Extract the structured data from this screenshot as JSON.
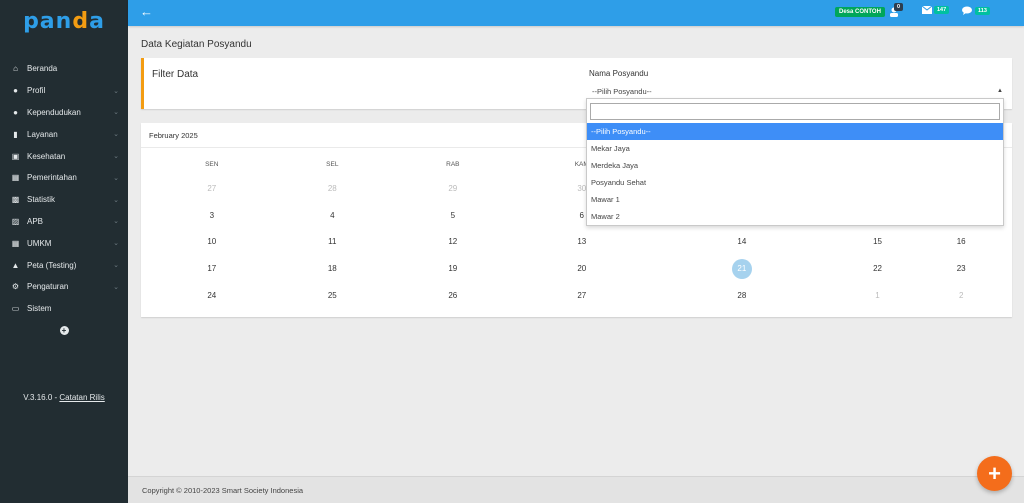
{
  "brand": {
    "logo_text": "panda"
  },
  "sidebar": {
    "items": [
      {
        "label": "Beranda",
        "icon": "home-icon",
        "has_children": false
      },
      {
        "label": "Profil",
        "icon": "user-icon",
        "has_children": true
      },
      {
        "label": "Kependudukan",
        "icon": "users-icon",
        "has_children": true
      },
      {
        "label": "Layanan",
        "icon": "file-icon",
        "has_children": true
      },
      {
        "label": "Kesehatan",
        "icon": "medkit-icon",
        "has_children": true
      },
      {
        "label": "Pemerintahan",
        "icon": "building-icon",
        "has_children": true
      },
      {
        "label": "Statistik",
        "icon": "bar-chart-icon",
        "has_children": true
      },
      {
        "label": "APB",
        "icon": "money-icon",
        "has_children": true
      },
      {
        "label": "UMKM",
        "icon": "grid-icon",
        "has_children": true
      },
      {
        "label": "Peta (Testing)",
        "icon": "map-icon",
        "has_children": true
      },
      {
        "label": "Pengaturan",
        "icon": "gear-icon",
        "has_children": true
      },
      {
        "label": "Sistem",
        "icon": "monitor-icon",
        "has_children": false
      }
    ],
    "version": "V.3.16.0 - ",
    "release_notes_link": "Catatan Rilis"
  },
  "topbar": {
    "desa_label": "Desa CONTOH",
    "notif_count": "0",
    "mail_count": "147",
    "chat_count": "113"
  },
  "page": {
    "title": "Data Kegiatan Posyandu",
    "filter_title": "Filter Data",
    "field_label": "Nama Posyandu",
    "select_value": "--Pilih Posyandu--"
  },
  "dropdown": {
    "search_value": "",
    "options": [
      "--Pilih Posyandu--",
      "Mekar Jaya",
      "Merdeka Jaya",
      "Posyandu Sehat",
      "Mawar 1",
      "Mawar 2"
    ],
    "selected_index": 0
  },
  "calendar": {
    "month_label": "February 2025",
    "weekdays": [
      "SEN",
      "SEL",
      "RAB",
      "KAM",
      "",
      "",
      ""
    ],
    "weeks": [
      [
        {
          "d": "27",
          "muted": true
        },
        {
          "d": "28",
          "muted": true
        },
        {
          "d": "29",
          "muted": true
        },
        {
          "d": "30",
          "muted": true
        },
        {
          "d": "",
          "muted": false
        },
        {
          "d": "",
          "muted": false
        },
        {
          "d": "",
          "muted": false
        }
      ],
      [
        {
          "d": "3"
        },
        {
          "d": "4"
        },
        {
          "d": "5"
        },
        {
          "d": "6"
        },
        {
          "d": ""
        },
        {
          "d": ""
        },
        {
          "d": ""
        }
      ],
      [
        {
          "d": "10"
        },
        {
          "d": "11"
        },
        {
          "d": "12"
        },
        {
          "d": "13"
        },
        {
          "d": "14"
        },
        {
          "d": "15"
        },
        {
          "d": "16"
        }
      ],
      [
        {
          "d": "17"
        },
        {
          "d": "18"
        },
        {
          "d": "19"
        },
        {
          "d": "20"
        },
        {
          "d": "21",
          "today": true
        },
        {
          "d": "22"
        },
        {
          "d": "23"
        }
      ],
      [
        {
          "d": "24"
        },
        {
          "d": "25"
        },
        {
          "d": "26"
        },
        {
          "d": "27"
        },
        {
          "d": "28"
        },
        {
          "d": "1",
          "muted": true
        },
        {
          "d": "2",
          "muted": true
        }
      ]
    ]
  },
  "footer": {
    "copyright": "Copyright © 2010-2023 Smart Society Indonesia"
  },
  "colors": {
    "sidebar": "#222d32",
    "topbar": "#2e9ee8",
    "accent": "#f39c12",
    "fab": "#f46d1b",
    "selected": "#3e8ef7"
  }
}
